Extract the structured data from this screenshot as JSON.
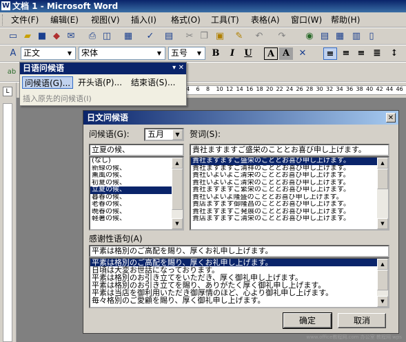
{
  "window": {
    "title": "文档 1 - Microsoft Word"
  },
  "menu": {
    "items": [
      "文件(F)",
      "编辑(E)",
      "视图(V)",
      "插入(I)",
      "格式(O)",
      "工具(T)",
      "表格(A)",
      "窗口(W)",
      "帮助(H)"
    ]
  },
  "format_toolbar": {
    "style": "正文",
    "font": "宋体",
    "size": "五号",
    "bold": "B",
    "italic": "I",
    "underline": "U",
    "char_border": "A",
    "char_shading": "A"
  },
  "ruler": {
    "tab_selector": "L",
    "ticks": [
      "4",
      "6",
      "8",
      "10",
      "12",
      "14",
      "16",
      "18",
      "20",
      "22",
      "24",
      "26",
      "28",
      "30",
      "32",
      "34",
      "36",
      "38",
      "40",
      "42",
      "44",
      "46"
    ]
  },
  "float_toolbar": {
    "title": "日语问候语",
    "greeting_btn": "问候语(G)...",
    "opening_btn": "开头语(P)...",
    "closing_btn": "结束语(S)...",
    "insert_prev": "插入原先的问候语(I)"
  },
  "dialog": {
    "title": "日文问候语",
    "greeting_label": "问候语(G):",
    "month_value": "五月",
    "greeting_input": "立夏の候、",
    "greeting_options": [
      "(なし)",
      "新緑の候、",
      "薫風の候、",
      "初夏の候、",
      "立夏の候、",
      "暮春の候、",
      "老春の候、",
      "晩春の候、",
      "軽暑の候、"
    ],
    "greeting_selected_index": 4,
    "congrats_label": "贺词(S):",
    "congrats_input": "貴社ますますご盛栄のこととお喜び申し上げます。",
    "congrats_options": [
      "貴社ますますご盛栄のこととお喜び申し上げます。",
      "貴社ますますご清祥のこととお喜び申し上げます。",
      "貴社いよいよご清栄のこととお喜び申し上げます。",
      "貴社いよいよご清栄のこととお喜び申し上げます。",
      "貴社ますますご繁栄のこととお喜び申し上げます。",
      "貴社いよいよ隆盛のこととお喜び申し上げます。",
      "貴店ますます御隆昌のこととお喜び申し上げます。",
      "貴社ますますご発展のこととお喜び申し上げます。",
      "貴店ますますご清栄のこととお喜び申し上げます。"
    ],
    "congrats_selected_index": 0,
    "thanks_label": "感谢性语句(A)",
    "thanks_input": "平素は格別のご高配を賜り、厚くお礼申し上げます。",
    "thanks_options": [
      "平素は格別のご高配を賜り、厚くお礼申し上げます。",
      "日頃は大変お世話になっております。",
      "平素は格別のお引き立てをいただき、厚く御礼申し上げます。",
      "平素は格別のお引き立てを賜り、ありがたく厚く御礼申し上げます。",
      "平素は当店を御利用いただき御厚情のほど、心より御礼申し上げます。",
      "毎々格別のご愛顧を賜り、厚く御礼申し上げます。"
    ],
    "thanks_selected_index": 0,
    "ok": "确定",
    "cancel": "取消"
  },
  "watermark": "www.office教程网.com 办公室 教程网 wps"
}
